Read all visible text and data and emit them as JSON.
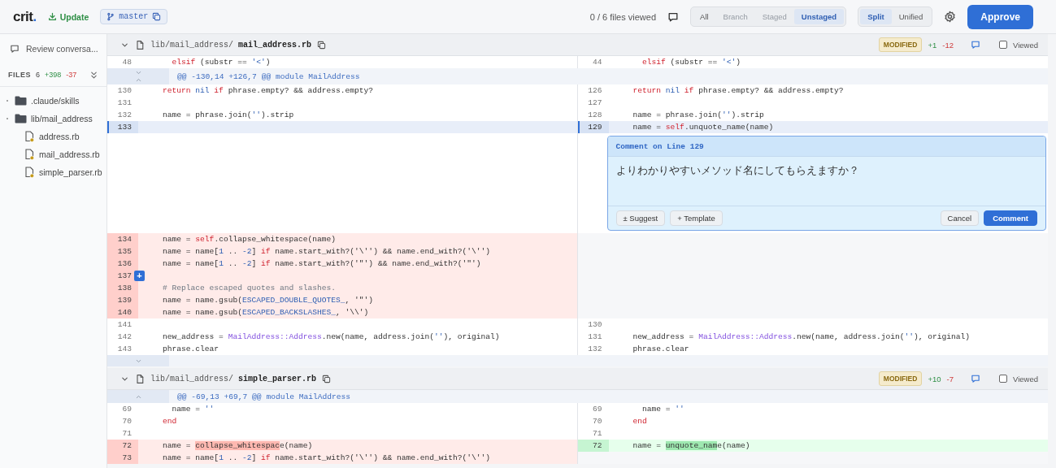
{
  "toolbar": {
    "logo": {
      "text": "crit",
      "accent": "."
    },
    "update_button": "Update",
    "branch": "master",
    "files_viewed": "0 / 6 files viewed",
    "scope_tabs": [
      {
        "label": "All",
        "selected": false,
        "disabled": false
      },
      {
        "label": "Branch",
        "selected": false,
        "disabled": true
      },
      {
        "label": "Staged",
        "selected": false,
        "disabled": true
      },
      {
        "label": "Unstaged",
        "selected": true,
        "disabled": false
      }
    ],
    "view_tabs": [
      {
        "label": "Split",
        "selected": true
      },
      {
        "label": "Unified",
        "selected": false
      }
    ],
    "approve_button": "Approve"
  },
  "sidebar": {
    "conversation_link": "Review conversa...",
    "files_label": "FILES",
    "file_count": "6",
    "additions": "+398",
    "deletions": "-37",
    "tree": [
      {
        "kind": "folder",
        "name": ".claude/skills"
      },
      {
        "kind": "folder",
        "name": "lib/mail_address",
        "children": [
          {
            "kind": "file",
            "name": "address.rb",
            "modified": true
          },
          {
            "kind": "file",
            "name": "mail_address.rb",
            "modified": true
          },
          {
            "kind": "file",
            "name": "simple_parser.rb",
            "modified": true
          }
        ]
      }
    ]
  },
  "files": [
    {
      "dir": "lib/mail_address/",
      "name": "mail_address.rb",
      "status": "MODIFIED",
      "additions": "+1",
      "deletions": "-12",
      "viewed": false,
      "viewed_label": "Viewed",
      "rows": [
        {
          "kind": "code",
          "left": {
            "kind": "context",
            "num": "48",
            "selected": false,
            "tokens": [
              {
                "text": "      elsif",
                "kind": "keyword"
              },
              {
                "text": " (substr == ",
                "kind": "plain"
              },
              {
                "text": "'<'",
                "kind": "string"
              },
              {
                "text": ")",
                "kind": "plain"
              }
            ]
          },
          "right": {
            "kind": "context",
            "num": "44",
            "selected": false,
            "tokens": [
              {
                "text": "      elsif",
                "kind": "keyword"
              },
              {
                "text": " (substr == ",
                "kind": "plain"
              },
              {
                "text": "'<'",
                "kind": "string"
              },
              {
                "text": ")",
                "kind": "plain"
              }
            ]
          }
        },
        {
          "kind": "hunk",
          "text": "@@ -130,14 +126,7 @@ module MailAddress",
          "expand_down": true,
          "expand_up": true
        },
        {
          "kind": "code",
          "left": {
            "kind": "context",
            "num": "130",
            "selected": false,
            "tokens": [
              {
                "text": "    return",
                "kind": "keyword"
              },
              {
                "text": " nil",
                "kind": "constant"
              },
              {
                "text": " if",
                "kind": "keyword"
              },
              {
                "text": " phrase.empty? && address.empty?",
                "kind": "plain"
              }
            ]
          },
          "right": {
            "kind": "context",
            "num": "126",
            "selected": false,
            "tokens": [
              {
                "text": "    return",
                "kind": "keyword"
              },
              {
                "text": " nil",
                "kind": "constant"
              },
              {
                "text": " if",
                "kind": "keyword"
              },
              {
                "text": " phrase.empty? && address.empty?",
                "kind": "plain"
              }
            ]
          }
        },
        {
          "kind": "code",
          "left": {
            "kind": "context",
            "num": "131",
            "selected": false
          },
          "right": {
            "kind": "context",
            "num": "127",
            "selected": false
          }
        },
        {
          "kind": "code",
          "left": {
            "kind": "context",
            "num": "132",
            "selected": false,
            "tokens": [
              {
                "text": "    name = phrase.join(",
                "kind": "plain"
              },
              {
                "text": "''",
                "kind": "string"
              },
              {
                "text": ").strip",
                "kind": "plain"
              }
            ]
          },
          "right": {
            "kind": "context",
            "num": "128",
            "selected": false,
            "tokens": [
              {
                "text": "    name = phrase.join(",
                "kind": "plain"
              },
              {
                "text": "''",
                "kind": "string"
              },
              {
                "text": ").strip",
                "kind": "plain"
              }
            ]
          }
        },
        {
          "kind": "code",
          "left": {
            "kind": "context",
            "num": "133",
            "selected": true
          },
          "right": {
            "kind": "context",
            "num": "129",
            "selected": true,
            "tokens": [
              {
                "text": "    name = ",
                "kind": "plain"
              },
              {
                "text": "self",
                "kind": "keyword"
              },
              {
                "text": ".unquote_name(name)",
                "kind": "plain"
              }
            ]
          }
        },
        {
          "kind": "comment",
          "title": "Comment on Line 129",
          "text": "よりわかりやすいメソッド名にしてもらえますか？",
          "buttons": [
            {
              "label": "± Suggest",
              "kind": "secondary"
            },
            {
              "label": "+ Template",
              "kind": "secondary"
            },
            {
              "label": "Cancel",
              "kind": "secondary"
            },
            {
              "label": "Comment",
              "kind": "primary"
            }
          ]
        },
        {
          "kind": "code",
          "left": {
            "kind": "deleted",
            "num": "134",
            "selected": false,
            "tokens": [
              {
                "text": "    name = ",
                "kind": "plain"
              },
              {
                "text": "self",
                "kind": "keyword"
              },
              {
                "text": ".collapse_whitespace(name)",
                "kind": "plain"
              }
            ]
          },
          "right": {
            "kind": "empty"
          }
        },
        {
          "kind": "code",
          "left": {
            "kind": "deleted",
            "num": "135",
            "selected": false,
            "tokens": [
              {
                "text": "    name = name[",
                "kind": "plain"
              },
              {
                "text": "1",
                "kind": "constant"
              },
              {
                "text": " .. ",
                "kind": "plain"
              },
              {
                "text": "-2",
                "kind": "constant"
              },
              {
                "text": "] ",
                "kind": "plain"
              },
              {
                "text": "if",
                "kind": "keyword"
              },
              {
                "text": " name.start_with?('\\'') && name.end_with?('\\'')",
                "kind": "plain"
              }
            ]
          },
          "right": {
            "kind": "empty"
          }
        },
        {
          "kind": "code",
          "left": {
            "kind": "deleted",
            "num": "136",
            "selected": false,
            "tokens": [
              {
                "text": "    name = name[",
                "kind": "plain"
              },
              {
                "text": "1",
                "kind": "constant"
              },
              {
                "text": " .. ",
                "kind": "plain"
              },
              {
                "text": "-2",
                "kind": "constant"
              },
              {
                "text": "] ",
                "kind": "plain"
              },
              {
                "text": "if",
                "kind": "keyword"
              },
              {
                "text": " name.start_with?('\"') && name.end_with?('\"')",
                "kind": "plain"
              }
            ]
          },
          "right": {
            "kind": "empty"
          }
        },
        {
          "kind": "code",
          "left": {
            "kind": "deleted",
            "num": "137",
            "selected": false,
            "action": "+"
          },
          "right": {
            "kind": "empty"
          }
        },
        {
          "kind": "code",
          "left": {
            "kind": "deleted",
            "num": "138",
            "selected": false,
            "tokens": [
              {
                "text": "    # Replace escaped quotes and slashes.",
                "kind": "comment"
              }
            ]
          },
          "right": {
            "kind": "empty"
          }
        },
        {
          "kind": "code",
          "left": {
            "kind": "deleted",
            "num": "139",
            "selected": false,
            "tokens": [
              {
                "text": "    name = name.gsub(",
                "kind": "plain"
              },
              {
                "text": "ESCAPED_DOUBLE_QUOTES_",
                "kind": "constant"
              },
              {
                "text": ", '\"')",
                "kind": "plain"
              }
            ]
          },
          "right": {
            "kind": "empty"
          }
        },
        {
          "kind": "code",
          "left": {
            "kind": "deleted",
            "num": "140",
            "selected": false,
            "tokens": [
              {
                "text": "    name = name.gsub(",
                "kind": "plain"
              },
              {
                "text": "ESCAPED_BACKSLASHES_",
                "kind": "constant"
              },
              {
                "text": ", '\\\\')",
                "kind": "plain"
              }
            ]
          },
          "right": {
            "kind": "empty"
          }
        },
        {
          "kind": "code",
          "left": {
            "kind": "context",
            "num": "141",
            "selected": false
          },
          "right": {
            "kind": "context",
            "num": "130",
            "selected": false
          }
        },
        {
          "kind": "code",
          "left": {
            "kind": "context",
            "num": "142",
            "selected": false,
            "tokens": [
              {
                "text": "    new_address = ",
                "kind": "plain"
              },
              {
                "text": "MailAddress::Address",
                "kind": "class"
              },
              {
                "text": ".new(name, address.join(",
                "kind": "plain"
              },
              {
                "text": "''",
                "kind": "string"
              },
              {
                "text": "), original)",
                "kind": "plain"
              }
            ]
          },
          "right": {
            "kind": "context",
            "num": "131",
            "selected": false,
            "tokens": [
              {
                "text": "    new_address = ",
                "kind": "plain"
              },
              {
                "text": "MailAddress::Address",
                "kind": "class"
              },
              {
                "text": ".new(name, address.join(",
                "kind": "plain"
              },
              {
                "text": "''",
                "kind": "string"
              },
              {
                "text": "), original)",
                "kind": "plain"
              }
            ]
          }
        },
        {
          "kind": "code",
          "left": {
            "kind": "context",
            "num": "143",
            "selected": false,
            "tokens": [
              {
                "text": "    phrase.clear",
                "kind": "plain"
              }
            ]
          },
          "right": {
            "kind": "context",
            "num": "132",
            "selected": false,
            "tokens": [
              {
                "text": "    phrase.clear",
                "kind": "plain"
              }
            ]
          }
        },
        {
          "kind": "expand"
        }
      ]
    },
    {
      "dir": "lib/mail_address/",
      "name": "simple_parser.rb",
      "status": "MODIFIED",
      "additions": "+10",
      "deletions": "-7",
      "viewed": false,
      "viewed_label": "Viewed",
      "rows": [
        {
          "kind": "hunk",
          "text": "@@ -69,13 +69,7 @@ module MailAddress",
          "expand_down": false,
          "expand_up": true
        },
        {
          "kind": "code",
          "left": {
            "kind": "context",
            "num": "69",
            "selected": false,
            "tokens": [
              {
                "text": "      name = ",
                "kind": "plain"
              },
              {
                "text": "''",
                "kind": "string"
              }
            ]
          },
          "right": {
            "kind": "context",
            "num": "69",
            "selected": false,
            "tokens": [
              {
                "text": "      name = ",
                "kind": "plain"
              },
              {
                "text": "''",
                "kind": "string"
              }
            ]
          }
        },
        {
          "kind": "code",
          "left": {
            "kind": "context",
            "num": "70",
            "selected": false,
            "tokens": [
              {
                "text": "    end",
                "kind": "keyword"
              }
            ]
          },
          "right": {
            "kind": "context",
            "num": "70",
            "selected": false,
            "tokens": [
              {
                "text": "    end",
                "kind": "keyword"
              }
            ]
          }
        },
        {
          "kind": "code",
          "left": {
            "kind": "context",
            "num": "71",
            "selected": false
          },
          "right": {
            "kind": "context",
            "num": "71",
            "selected": false
          }
        },
        {
          "kind": "code",
          "left": {
            "kind": "deleted",
            "num": "72",
            "selected": false,
            "tokens": [
              {
                "text": "    name = ",
                "kind": "plain"
              },
              {
                "text": "collapse_whitespac",
                "kind": "changed"
              },
              {
                "text": "e(name)",
                "kind": "plain"
              }
            ]
          },
          "right": {
            "kind": "added",
            "num": "72",
            "selected": false,
            "tokens": [
              {
                "text": "    name = ",
                "kind": "plain"
              },
              {
                "text": "unquote_nam",
                "kind": "changed"
              },
              {
                "text": "e(name)",
                "kind": "plain"
              }
            ]
          }
        },
        {
          "kind": "code",
          "left": {
            "kind": "deleted",
            "num": "73",
            "selected": false,
            "tokens": [
              {
                "text": "    name = name[",
                "kind": "plain"
              },
              {
                "text": "1",
                "kind": "constant"
              },
              {
                "text": " .. ",
                "kind": "plain"
              },
              {
                "text": "-2",
                "kind": "constant"
              },
              {
                "text": "] ",
                "kind": "plain"
              },
              {
                "text": "if",
                "kind": "keyword"
              },
              {
                "text": " name.start_with?('\\'') && name.end_with?('\\'')",
                "kind": "plain"
              }
            ]
          },
          "right": {
            "kind": "empty"
          }
        }
      ]
    }
  ]
}
